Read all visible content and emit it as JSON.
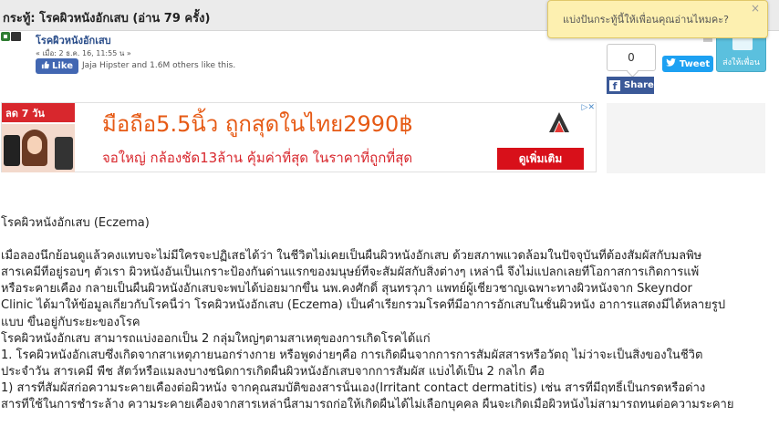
{
  "topbar": {
    "title": "กระทู้: โรคผิวหนังอักเสบ  (อ่าน 79 ครั้ง)"
  },
  "post": {
    "title": "โรคผิวหนังอักเสบ",
    "date": "« เมื่อ: 2 ธ.ค. 16, 11:55 น »",
    "like_label": "Like",
    "like_text": "Jaja Hipster and 1.6M others like this."
  },
  "share": {
    "count": "0",
    "facebook_label": "Share",
    "tweet_label": "Tweet",
    "send_label": "ส่งให้เพื่อน"
  },
  "popup": {
    "text": "แบ่งปันกระทู้นี้ให้เพื่อนคุณอ่านไหมคะ?",
    "close": "×"
  },
  "ad": {
    "badge": "ลด 7 วัน",
    "headline": "มือถือ5.5นิ้ว ถูกสุดในไทย2990฿",
    "subline": "จอใหญ่ กล้องชัด13ล้าน คุ้มค่าที่สุด ในราคาที่ถูกที่สุด",
    "cta": "ดูเพิ่มเติม",
    "choice": "▷✕"
  },
  "content": {
    "lines": [
      "โรคผิวหนังอักเสบ (Eczema)",
      "",
      "เมื่อลองนึกย้อนดูแล้วคงแทบจะไม่มีใครจะปฏิเสธได้ว่า ในชีวิตไม่เคยเป็นผื่นผิวหนังอักเสบ ด้วยสภาพแวดล้อมในปัจจุบันที่ต้องสัมผัสกับมลพิษ",
      "สารเคมีที่อยู่รอบๆ ตัวเรา ผิวหนังอันเป็นเกราะป้องกันด่านแรกของมนุษย์ที่จะสัมผัสกับสิ่งต่างๆ เหล่านี้ จึงไม่แปลกเลยที่โอกาสการเกิดการแพ้",
      "หรือระคายเคือง กลายเป็นผื่นผิวหนังอักเสบจะพบได้บ่อยมากขึ้น นพ.คงศักดิ์  สุนทรวุภา แพทย์ผู้เชี่ยวชาญเฉพาะทางผิวหนังจาก Skeyndor",
      "Clinic ได้มาให้ข้อมูลเกี่ยวกับโรคนี้ว่า  โรคผิวหนังอักเสบ (Eczema) เป็นคำเรียกรวมโรคที่มีอาการอักเสบในชั้นผิวหนัง อาการแสดงมีได้หลายรูป",
      "แบบ ขึ้นอยู่กับระยะของโรค",
      "โรคผิวหนังอักเสบ สามารถแบ่งออกเป็น 2 กลุ่มใหญ่ๆตามสาเหตุของการเกิดโรคได้แก่",
      "1.    โรคผิวหนังอักเสบซึ่งเกิดจากสาเหตุภายนอกร่างกาย หรือพูดง่ายๆคือ การเกิดผื่นจากการการสัมผัสสารหรือวัตถุ ไม่ว่าจะเป็นสิ่งของในชีวิต",
      "ประจำวัน สารเคมี พืช สัตว์หรือแมลงบางชนิดการเกิดผื่นผิวหนังอักเสบจากการสัมผัส แบ่งได้เป็น 2 กลไก คือ",
      "1)    สารที่สัมผัสก่อความระคายเคืองต่อผิวหนัง จากคุณสมบัติของสารนั้นเอง(Irritant contact dermatitis) เช่น สารที่มีฤทธิ์เป็นกรดหรือด่าง",
      "สารที่ใช้ในการชำระล้าง ความระคายเคืองจากสารเหล่านี้สามารถก่อให้เกิดผื่นได้ไม่เลือกบุคคล ผื่นจะเกิดเมื่อผิวหนังไม่สามารถทนต่อความระคาย"
    ]
  },
  "colors": {
    "link": "#2a4d8a",
    "facebook": "#3b5998",
    "twitter": "#1da1f2",
    "ad_red": "#d8272d",
    "ad_orange": "#e65a15",
    "popup_bg": "#fdf0b0"
  }
}
